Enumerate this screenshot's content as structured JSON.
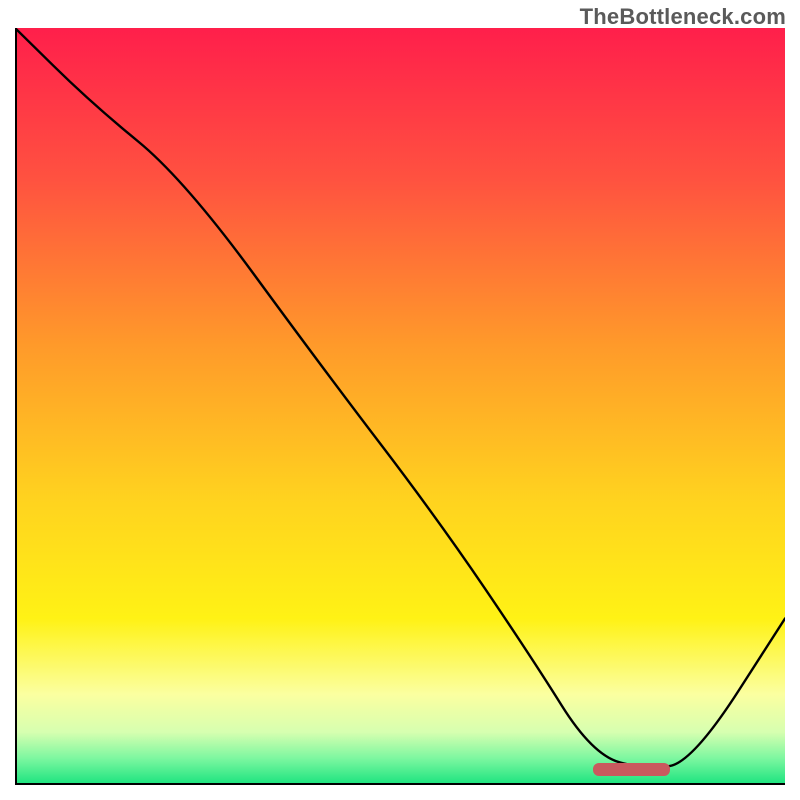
{
  "watermark": "TheBottleneck.com",
  "chart_data": {
    "type": "line",
    "title": "",
    "xlabel": "",
    "ylabel": "",
    "xlim": [
      0,
      100
    ],
    "ylim": [
      0,
      100
    ],
    "grid": false,
    "legend": false,
    "background_gradient": {
      "stops": [
        {
          "offset": 0.0,
          "color": "#ff1f4b"
        },
        {
          "offset": 0.2,
          "color": "#ff5240"
        },
        {
          "offset": 0.42,
          "color": "#ff9a2a"
        },
        {
          "offset": 0.62,
          "color": "#ffd21f"
        },
        {
          "offset": 0.78,
          "color": "#fff215"
        },
        {
          "offset": 0.88,
          "color": "#fbffa0"
        },
        {
          "offset": 0.93,
          "color": "#d7ffb0"
        },
        {
          "offset": 0.965,
          "color": "#7cf7a0"
        },
        {
          "offset": 1.0,
          "color": "#19e37e"
        }
      ]
    },
    "series": [
      {
        "name": "bottleneck-curve",
        "x": [
          0,
          10,
          22,
          40,
          55,
          67,
          75,
          82,
          88,
          100
        ],
        "y": [
          100,
          90,
          80,
          55,
          35,
          17,
          4,
          2,
          3,
          22
        ]
      }
    ],
    "marker": {
      "name": "optimal-range",
      "x_start": 75,
      "x_end": 85,
      "y": 2,
      "color": "#c9595e"
    }
  }
}
